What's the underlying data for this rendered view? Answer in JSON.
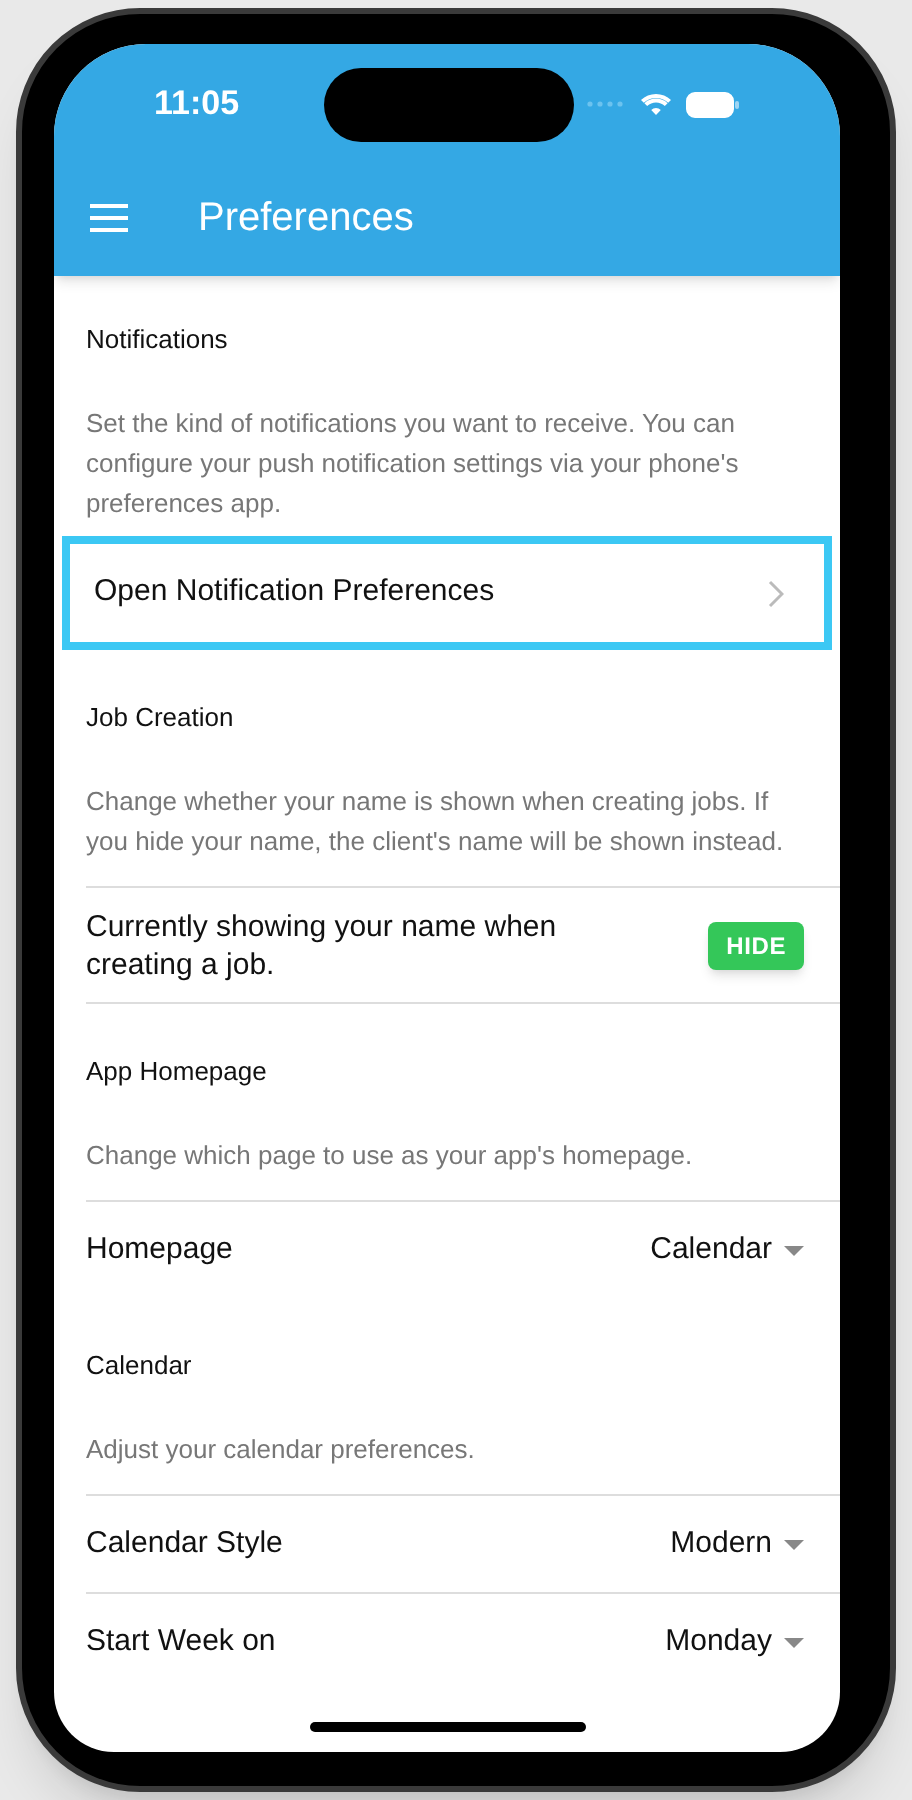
{
  "status_bar": {
    "time": "11:05"
  },
  "app_bar": {
    "title": "Preferences"
  },
  "sections": [
    {
      "title": "Notifications",
      "description": "Set the kind of notifications you want to receive. You can configure your push notification settings via your phone's preferences app.",
      "rows": [
        {
          "kind": "link",
          "label": "Open Notification Preferences",
          "focused": true
        }
      ]
    },
    {
      "title": "Job Creation",
      "description": "Change whether your name is shown when creating jobs. If you hide your name, the client's name will be shown instead.",
      "rows": [
        {
          "kind": "action",
          "label": "Currently showing your name when creating a job.",
          "button": "HIDE"
        }
      ]
    },
    {
      "title": "App Homepage",
      "description": "Change which page to use as your app's homepage.",
      "rows": [
        {
          "kind": "select",
          "label": "Homepage",
          "value": "Calendar"
        }
      ]
    },
    {
      "title": "Calendar",
      "description": "Adjust your calendar preferences.",
      "rows": [
        {
          "kind": "select",
          "label": "Calendar Style",
          "value": "Modern"
        },
        {
          "kind": "select",
          "label": "Start Week on",
          "value": "Monday"
        }
      ]
    }
  ]
}
